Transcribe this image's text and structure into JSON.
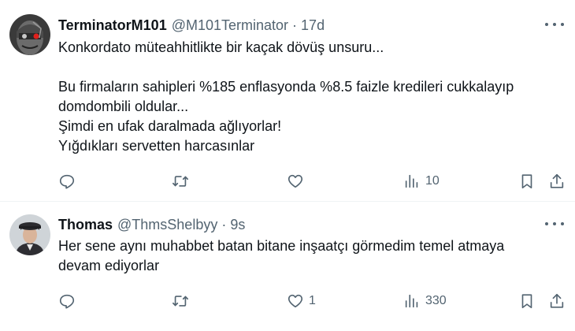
{
  "colors": {
    "text": "#0f1419",
    "secondary": "#536471",
    "divider": "#eff3f4"
  },
  "tweets": [
    {
      "name": "TerminatorM101",
      "handle": "@M101Terminator",
      "separator": "·",
      "time": "17d",
      "lines": [
        "Konkordato müteahhitlikte bir kaçak dövüş unsuru...",
        "",
        "Bu firmaların sahipleri %185 enflasyonda %8.5 faizle kredileri cukkalayıp",
        "domdombili oldular...",
        "Şimdi en ufak daralmada ağlıyorlar!",
        "Yığdıkları servetten harcasınlar"
      ],
      "views": "10",
      "likes": ""
    },
    {
      "name": "Thomas",
      "handle": "@ThmsShelbyy",
      "separator": "·",
      "time": "9s",
      "lines": [
        "Her sene aynı muhabbet batan bitane inşaatçı görmedim temel atmaya",
        "devam ediyorlar"
      ],
      "views": "330",
      "likes": "1"
    }
  ],
  "icons": [
    "reply-icon",
    "retweet-icon",
    "like-icon",
    "views-icon",
    "bookmark-icon",
    "share-icon",
    "more-icon"
  ]
}
